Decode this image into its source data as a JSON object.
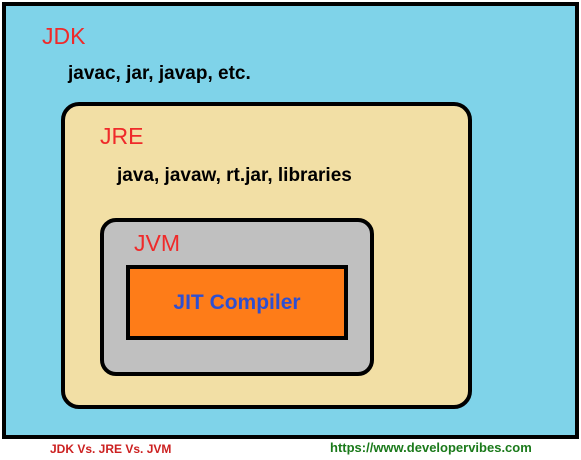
{
  "jdk": {
    "title": "JDK",
    "contents": "javac, jar, javap, etc."
  },
  "jre": {
    "title": "JRE",
    "contents": "java, javaw, rt.jar, libraries"
  },
  "jvm": {
    "title": "JVM"
  },
  "jit": {
    "label": "JIT Compiler"
  },
  "footer": {
    "caption": "JDK Vs. JRE Vs. JVM",
    "url": "https://www.developervibes.com"
  },
  "colors": {
    "jdk_fill": "#7fd3e9",
    "jre_fill": "#f2dfa5",
    "jvm_fill": "#c0c0c0",
    "jit_fill": "#fe7c18",
    "title_red": "#ef2a2a",
    "jit_text_blue": "#2e4fd1",
    "caption_red": "#cc2020",
    "url_green": "#1b7a1b"
  }
}
